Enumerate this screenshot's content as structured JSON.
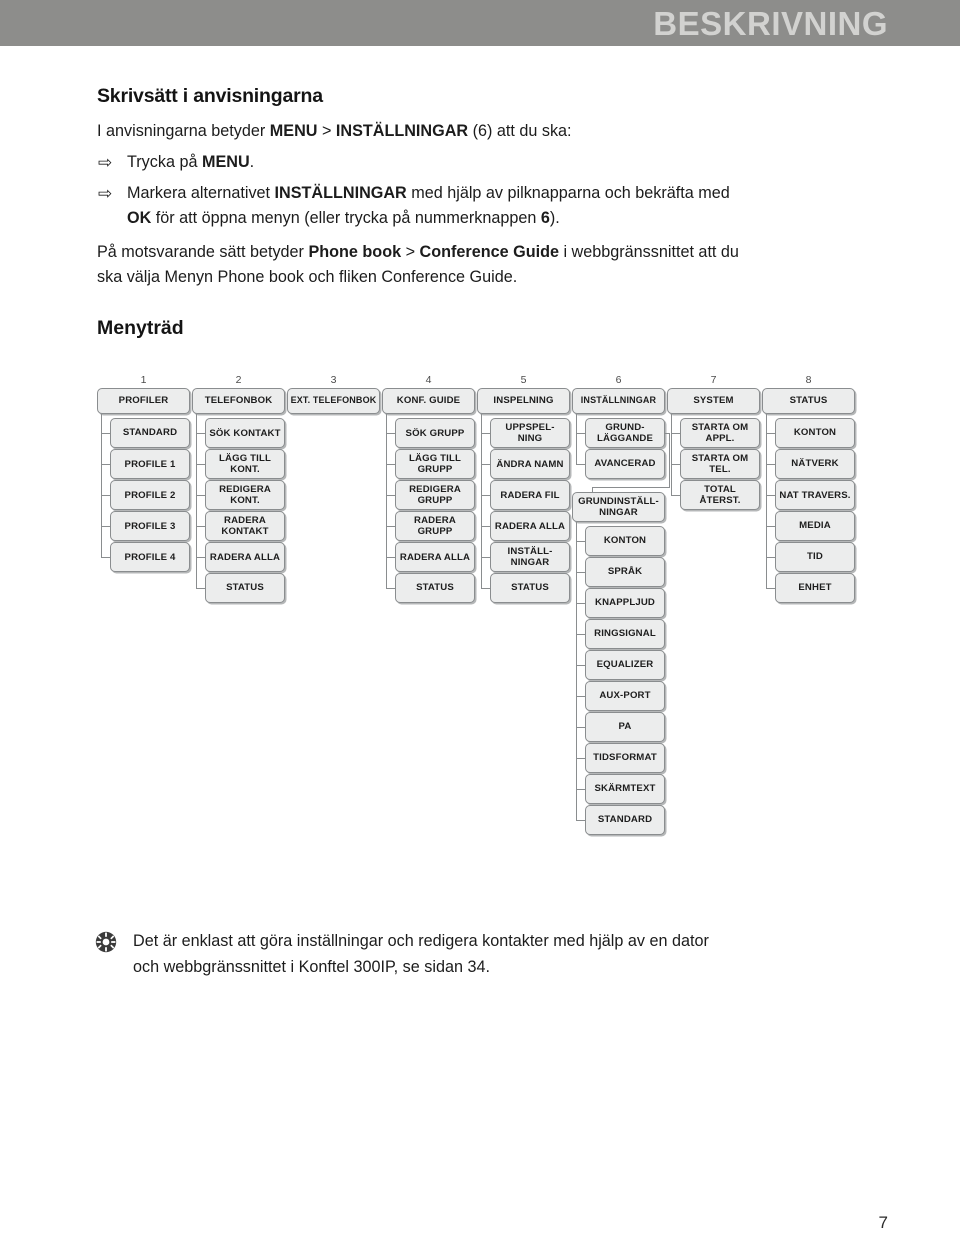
{
  "header": {
    "title": "BESKRIVNING",
    "band_color": "#8d8d8b",
    "text_color": "#d2d2d0"
  },
  "section": {
    "title": "Skrivsätt i anvisningarna",
    "intro_lead": "I anvisningarna betyder ",
    "intro_menu": "MENU",
    "intro_gt": " > ",
    "intro_settings": "INSTÄLLNINGAR",
    "intro_tail": " (6) att du ska:",
    "bullets": [
      {
        "arrow": "right-arrow-icon",
        "pre": "Trycka på ",
        "bold": "MENU",
        "post": "."
      },
      {
        "arrow": "right-arrow-icon",
        "pre": "Markera alternativet ",
        "bold": "INSTÄLLNINGAR",
        "post": " med hjälp av pilknapparna och bekräfta med",
        "line2_bold": "OK",
        "line2_text": " för att öppna menyn (eller trycka på nummerknappen ",
        "line2_bold2": "6",
        "line2_tail": ")."
      }
    ],
    "para2_a": "På motsvarande sätt betyder ",
    "para2_b": "Phone book",
    "para2_c": " > ",
    "para2_d": "Conference Guide",
    "para2_e": " i webbgränssnittet att du",
    "para2_line2": "ska välja Menyn Phone book och fliken Conference Guide."
  },
  "tree": {
    "title": "Menyträd",
    "columns": [
      {
        "number": "1",
        "root": "PROFILER",
        "children": [
          "STANDARD",
          "PROFILE 1",
          "PROFILE 2",
          "PROFILE 3",
          "PROFILE 4"
        ]
      },
      {
        "number": "2",
        "root": "TELEFONBOK",
        "children": [
          "SÖK KONTAKT",
          "LÄGG TILL KONT.",
          "REDIGERA KONT.",
          "RADERA KONTAKT",
          "RADERA ALLA",
          "STATUS"
        ]
      },
      {
        "number": "3",
        "root": "EXT. TELEFONBOK",
        "children": []
      },
      {
        "number": "4",
        "root": "KONF. GUIDE",
        "children": [
          "SÖK GRUPP",
          "LÄGG TILL GRUPP",
          "REDIGERA GRUPP",
          "RADERA GRUPP",
          "RADERA ALLA",
          "STATUS"
        ]
      },
      {
        "number": "5",
        "root": "INSPELNING",
        "children": [
          "UPPSPEL- NING",
          "ÄNDRA NAMN",
          "RADERA FIL",
          "RADERA ALLA",
          "INSTÄLL- NINGAR",
          "STATUS"
        ]
      },
      {
        "number": "6",
        "root": "INSTÄLLNINGAR",
        "children": [
          "GRUND- LÄGGANDE",
          "AVANCERAD"
        ],
        "sub_root": "GRUNDINSTÄLL- NINGAR",
        "sub_children": [
          "KONTON",
          "SPRÅK",
          "KNAPPLJUD",
          "RINGSIGNAL",
          "EQUALIZER",
          "AUX-PORT",
          "PA",
          "TIDSFORMAT",
          "SKÄRMTEXT",
          "STANDARD"
        ]
      },
      {
        "number": "7",
        "root": "SYSTEM",
        "children": [
          "STARTA OM APPL.",
          "STARTA OM TEL.",
          "TOTAL ÅTERST."
        ]
      },
      {
        "number": "8",
        "root": "STATUS",
        "children": [
          "KONTON",
          "NÄTVERK",
          "NAT TRAVERS.",
          "MEDIA",
          "TID",
          "ENHET"
        ]
      }
    ],
    "node_fill": "#eceded",
    "node_border": "#8a8d8f"
  },
  "tip": {
    "icon": "star-tip-icon",
    "line1": "Det är enklast att göra inställningar och redigera kontakter med hjälp av en dator",
    "line2": "och webbgränssnittet i Konftel 300IP, se sidan 34."
  },
  "footer": {
    "page_number": "7"
  }
}
